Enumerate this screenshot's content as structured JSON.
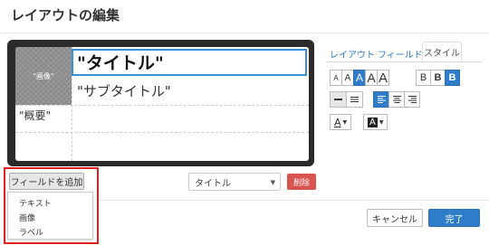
{
  "header": {
    "title": "レイアウトの編集"
  },
  "preview": {
    "image_placeholder": "\"画像\"",
    "title_field": "\"タイトル\"",
    "subtitle_field": "\"サブタイトル\"",
    "summary_field": "\"概要\""
  },
  "tabs": [
    {
      "label": "レイアウト"
    },
    {
      "label": "フィールド"
    },
    {
      "label": "スタイル",
      "active": true
    }
  ],
  "style_panel": {
    "font_sizes": [
      "A",
      "A",
      "A",
      "A",
      "A"
    ],
    "font_size_selected": 2,
    "weights": [
      "B",
      "B",
      "B"
    ],
    "weight_selected": 2,
    "spacing": [
      "line-spacing-tight-icon",
      "line-spacing-normal-icon"
    ],
    "spacing_selected": 0,
    "aligns": [
      "align-left-icon",
      "align-center-icon",
      "align-right-icon"
    ],
    "align_selected": 0,
    "text_color_label": "A",
    "bg_color_label": "A"
  },
  "add_field": {
    "label": "フィールドを追加",
    "menu": [
      "テキスト",
      "画像",
      "ラベル"
    ]
  },
  "field_select": {
    "value": "タイトル"
  },
  "delete_label": "削除",
  "footer": {
    "cancel_label": "キャンセル",
    "done_label": "完了"
  },
  "colors": {
    "accent": "#2f7dc9",
    "danger": "#d9534f",
    "highlight": "#e02020"
  }
}
